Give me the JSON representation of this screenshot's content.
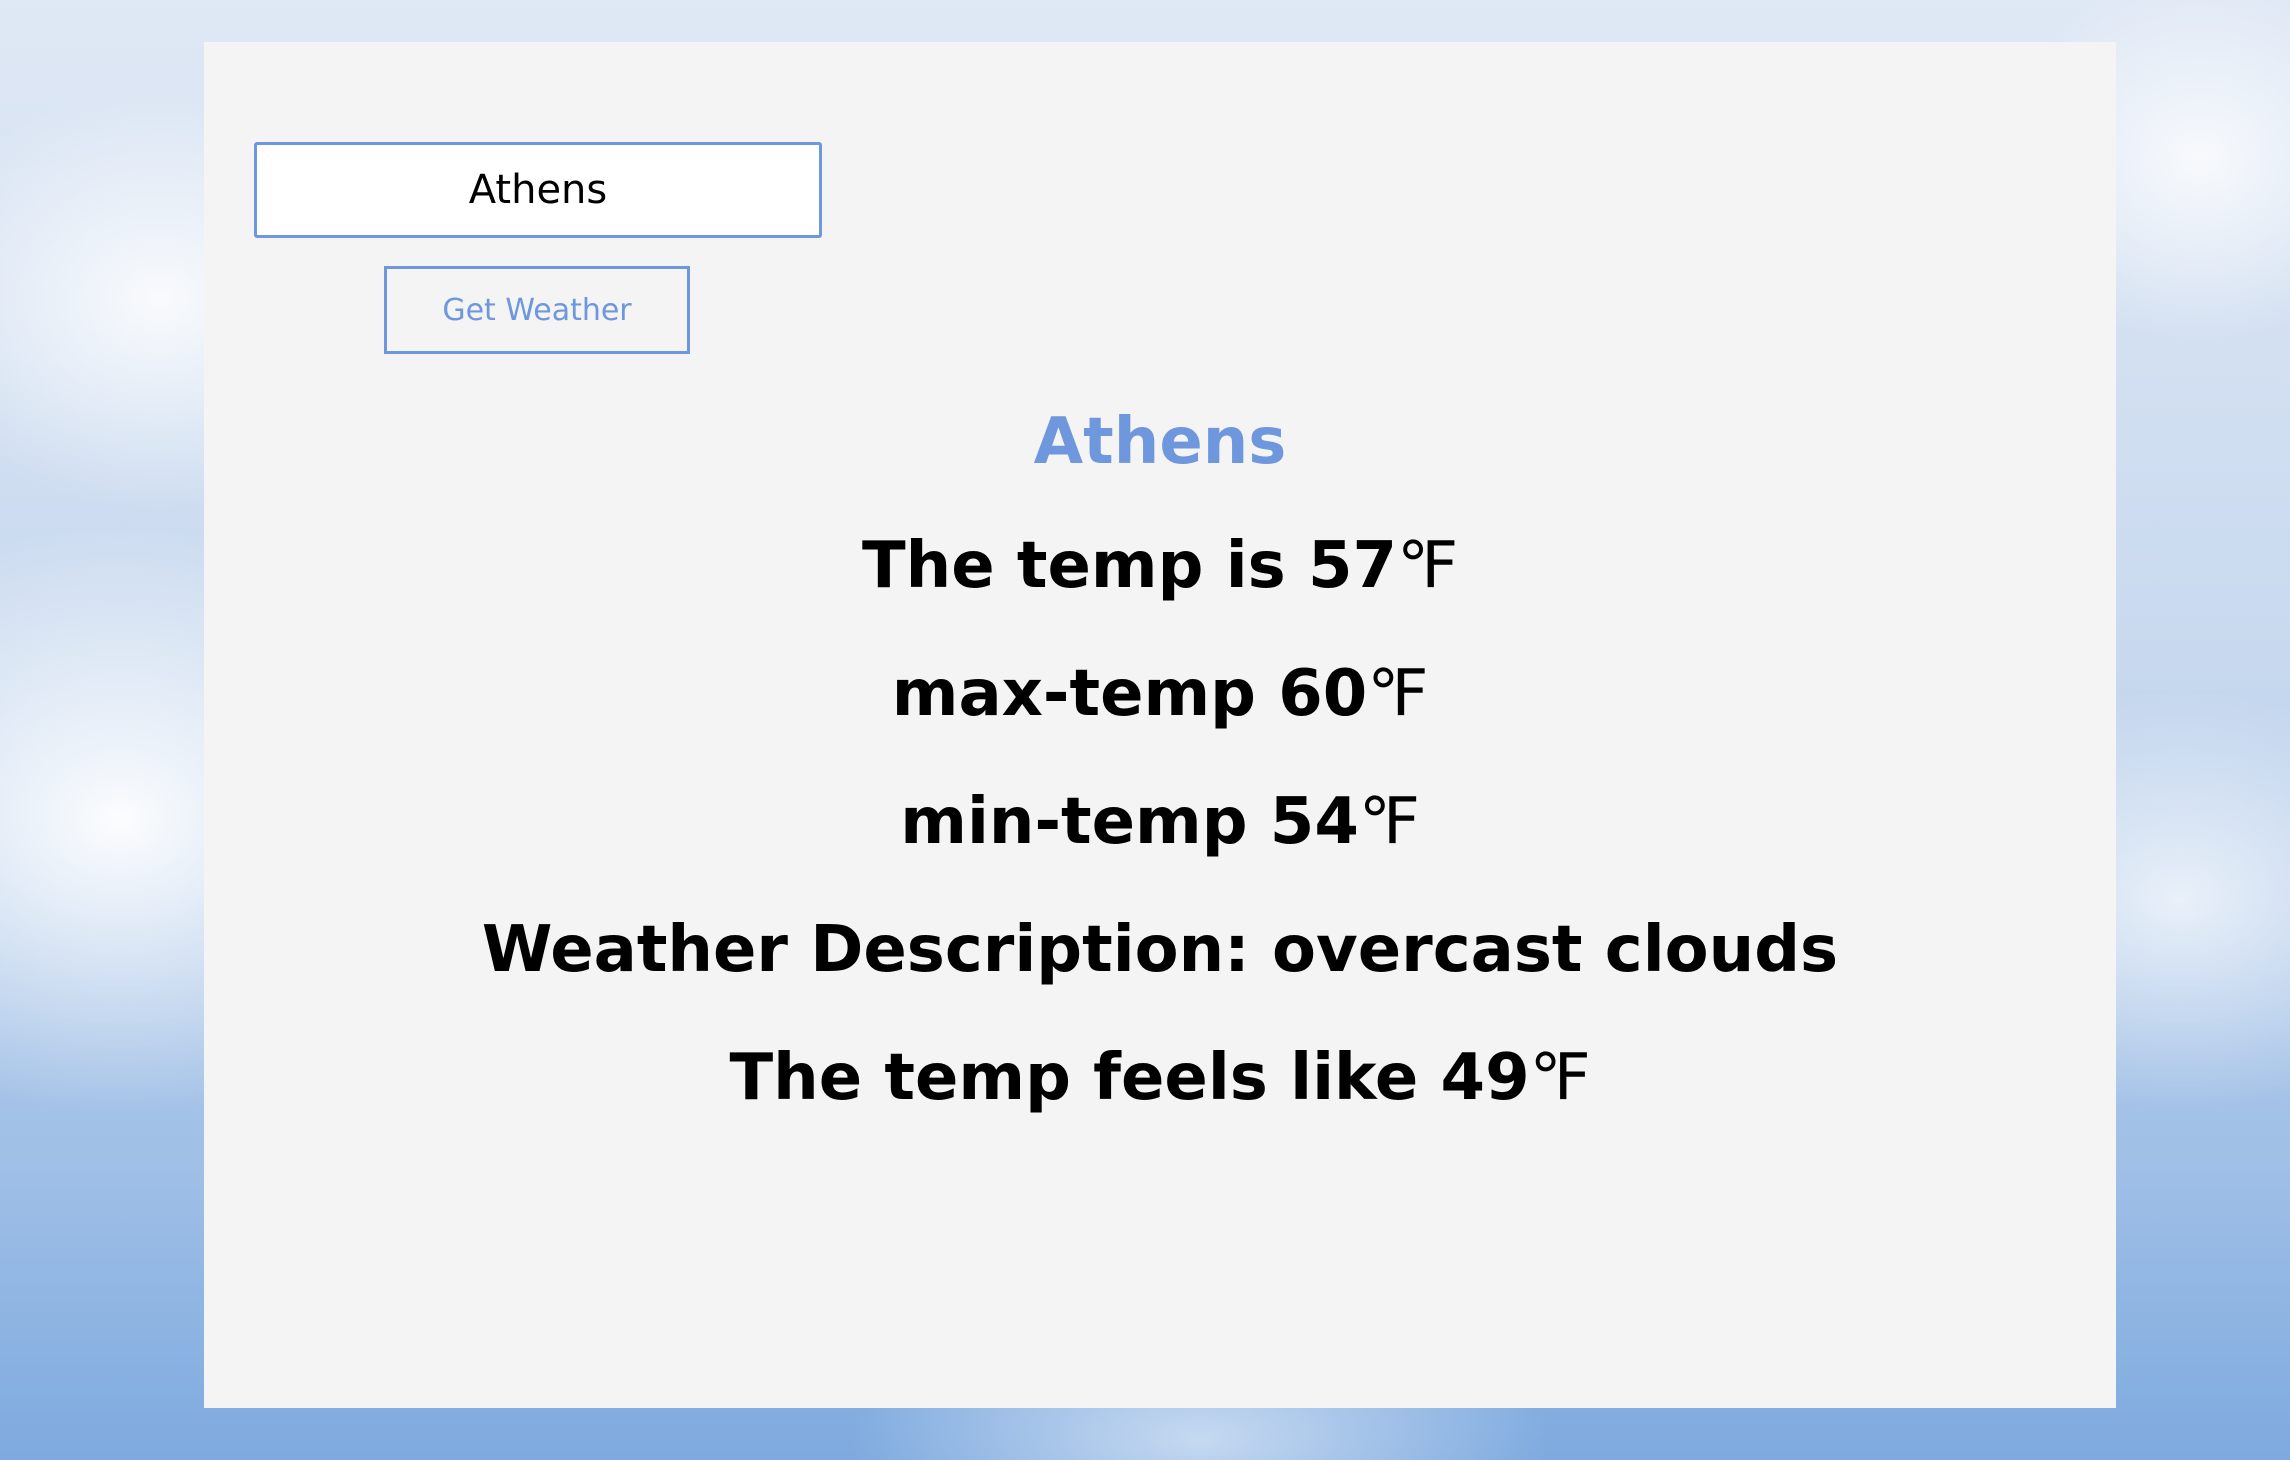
{
  "search": {
    "value": "Athens",
    "button_label": "Get Weather"
  },
  "result": {
    "city": "Athens",
    "temp_prefix": "The temp is ",
    "temp_value": "57",
    "max_prefix": "max-temp ",
    "max_value": "60",
    "min_prefix": "min-temp ",
    "min_value": "54",
    "description_text": "Weather Description: overcast clouds",
    "feels_prefix": "The temp feels like ",
    "feels_value": "49",
    "unit": "℉"
  },
  "colors": {
    "accent": "#6f97dd",
    "card_background": "#f4f4f4",
    "text": "#000000"
  }
}
